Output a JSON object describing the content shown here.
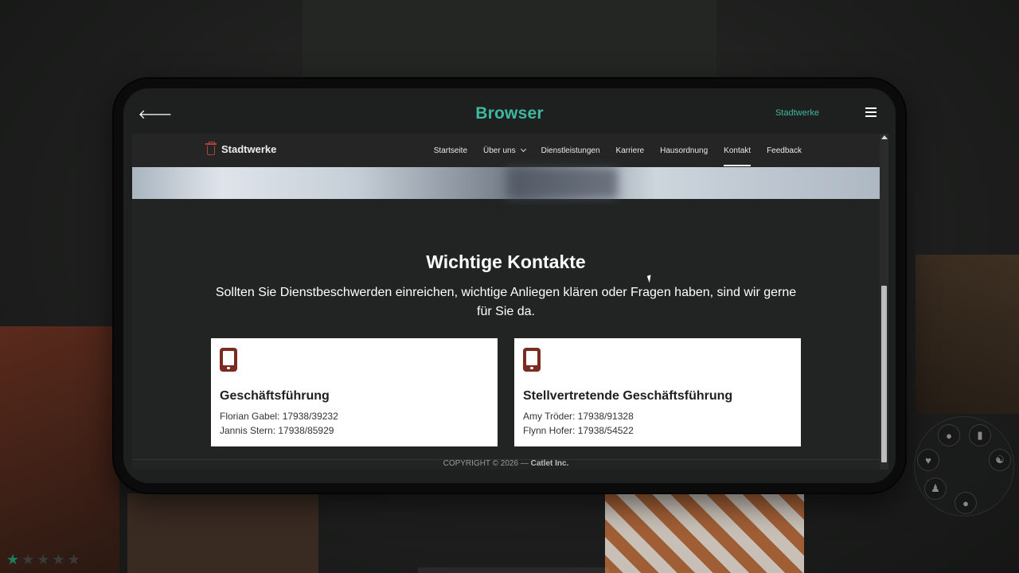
{
  "browser": {
    "title": "Browser",
    "tab_label": "Stadtwerke"
  },
  "site": {
    "logo_text": "Stadtwerke",
    "nav": [
      {
        "label": "Startseite"
      },
      {
        "label": "Über uns"
      },
      {
        "label": "Dienstleistungen"
      },
      {
        "label": "Karriere"
      },
      {
        "label": "Hausordnung"
      },
      {
        "label": "Kontakt"
      },
      {
        "label": "Feedback"
      }
    ],
    "active_nav": "Kontakt"
  },
  "contacts": {
    "title": "Wichtige Kontakte",
    "subtitle": "Sollten Sie Dienstbeschwerden einreichen, wichtige Anliegen klären oder Fragen haben, sind wir gerne für Sie da.",
    "cards": [
      {
        "title": "Geschäftsführung",
        "lines": [
          "Florian Gabel: 17938/39232",
          "Jannis Stern: 17938/85929"
        ]
      },
      {
        "title": "Stellvertretende Geschäftsführung",
        "lines": [
          "Amy Tröder: 17938/91328",
          "Flynn Hofer: 17938/54522"
        ]
      }
    ]
  },
  "footer": {
    "prefix": "COPYRIGHT © 2026 — ",
    "company": "Catlet Inc."
  },
  "hud": {
    "wanted_stars_filled": 1,
    "wanted_stars_total": 5
  },
  "colors": {
    "accent": "#3fb8a0",
    "logo_icon": "#b0413b",
    "phone_icon": "#7a2c22",
    "star_filled": "#1f7d5a"
  }
}
